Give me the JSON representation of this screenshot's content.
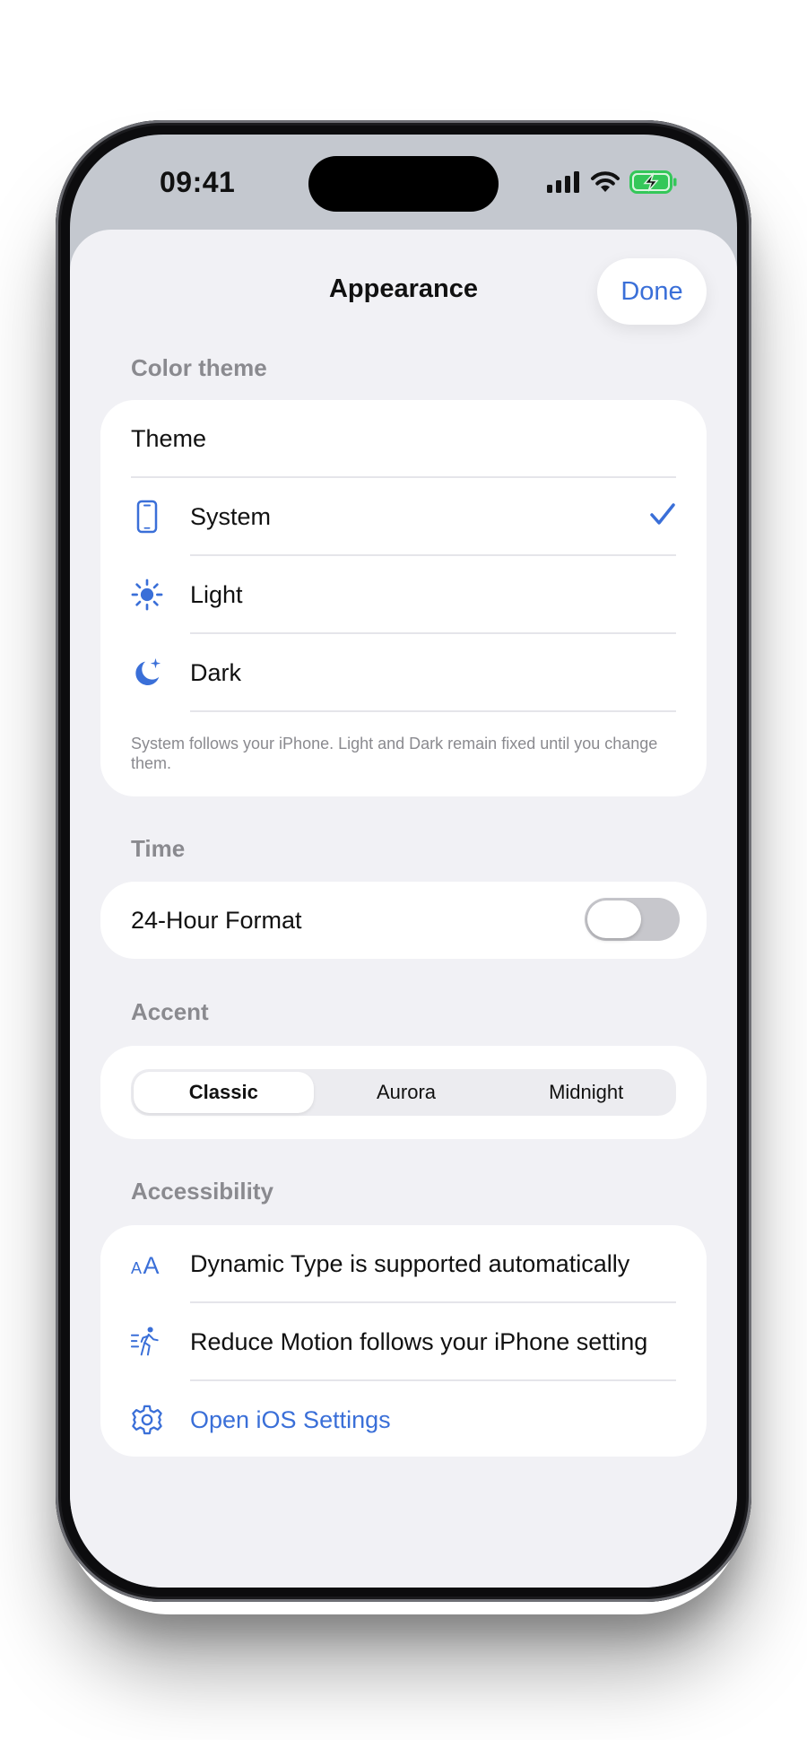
{
  "status_bar": {
    "time": "09:41"
  },
  "nav": {
    "title": "Appearance",
    "done_label": "Done"
  },
  "color_theme": {
    "header": "Color theme",
    "title_row": "Theme",
    "options": [
      {
        "label": "System",
        "icon": "iphone-icon",
        "selected": true
      },
      {
        "label": "Light",
        "icon": "sun-icon",
        "selected": false
      },
      {
        "label": "Dark",
        "icon": "moon-stars-icon",
        "selected": false
      }
    ],
    "footnote": "System follows your iPhone. Light and Dark remain fixed until you change them."
  },
  "time": {
    "header": "Time",
    "format_label": "24-Hour Format",
    "format_enabled": false
  },
  "accent": {
    "header": "Accent",
    "options": [
      "Classic",
      "Aurora",
      "Midnight"
    ],
    "selected": "Classic"
  },
  "accessibility": {
    "header": "Accessibility",
    "rows": [
      {
        "label": "Dynamic Type is supported automatically",
        "icon": "text-size-icon"
      },
      {
        "label": "Reduce Motion follows your iPhone setting",
        "icon": "figure-walk-motion-icon"
      },
      {
        "label": "Open iOS Settings",
        "icon": "gear-icon"
      }
    ]
  },
  "colors": {
    "accent_blue": "#3a6fd8",
    "sheet_background": "#f1f1f5",
    "battery_green": "#34c759"
  }
}
